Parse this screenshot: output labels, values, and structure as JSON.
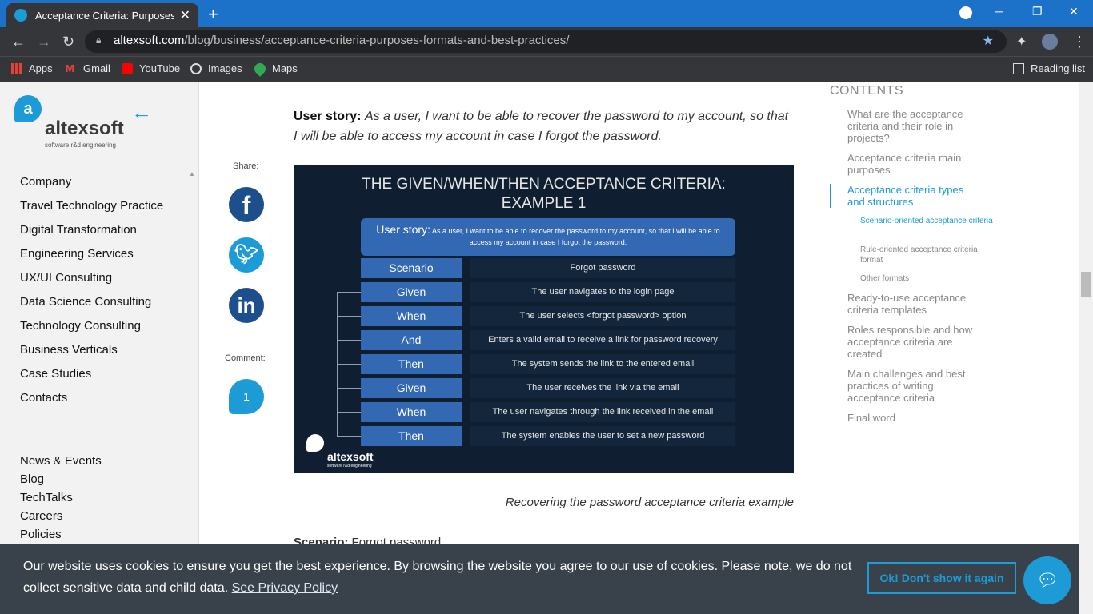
{
  "browser": {
    "tab_title": "Acceptance Criteria: Purposes, Ty",
    "tab_close": "✕",
    "new_tab": "+",
    "url_host": "altexsoft.com",
    "url_path": "/blog/business/acceptance-criteria-purposes-formats-and-best-practices/",
    "bookmarks": [
      "Apps",
      "Gmail",
      "YouTube",
      "Images",
      "Maps"
    ],
    "reading_list": "Reading list"
  },
  "logo": {
    "name": "altexsoft",
    "tagline": "software r&d engineering"
  },
  "sidebar": {
    "items": [
      "Company",
      "Travel Technology Practice",
      "Digital Transformation",
      "Engineering Services",
      "UX/UI Consulting",
      "Data Science Consulting",
      "Technology Consulting",
      "Business Verticals",
      "Case Studies",
      "Contacts"
    ],
    "secondary": [
      "News & Events",
      "Blog",
      "TechTalks",
      "Careers",
      "Policies"
    ]
  },
  "share": {
    "label": "Share:",
    "comment_label": "Comment:",
    "comment_count": "1"
  },
  "article": {
    "story_label": "User story:",
    "story_text": "As a user, I want to be able to recover the password to my account, so that I will be able to access my account in case I forgot the password.",
    "caption": "Recovering the password acceptance criteria example",
    "cut_label": "Scenario:",
    "cut_text": "Forgot password"
  },
  "infographic": {
    "title_line1": "THE GIVEN/WHEN/THEN ACCEPTANCE CRITERIA:",
    "title_line2": "EXAMPLE 1",
    "story_label": "User story:",
    "story_text": "As a user, I want to be able to recover the password to my account, so that I will be able to access my account in case I forgot the password.",
    "rows": [
      {
        "term": "Scenario",
        "desc": "Forgot password"
      },
      {
        "term": "Given",
        "desc": "The user navigates to the login page"
      },
      {
        "term": "When",
        "desc": "The user selects <forgot password> option"
      },
      {
        "term": "And",
        "desc": "Enters a valid email to receive a link for password recovery"
      },
      {
        "term": "Then",
        "desc": "The system sends the link to the entered email"
      },
      {
        "term": "Given",
        "desc": "The user receives the link via the email"
      },
      {
        "term": "When",
        "desc": "The user navigates through the link received in the email"
      },
      {
        "term": "Then",
        "desc": "The system enables the user to set a new password"
      }
    ],
    "logo_name": "altexsoft",
    "logo_sub": "software r&d engineering"
  },
  "toc": {
    "heading": "CONTENTS",
    "items": [
      "What are the acceptance criteria and their role in projects?",
      "Acceptance criteria main purposes",
      "Acceptance criteria types and structures",
      "Scenario-oriented acceptance criteria",
      "Rule-oriented acceptance criteria format",
      "Other formats",
      "Ready-to-use acceptance criteria templates",
      "Roles responsible and how acceptance criteria are created",
      "Main challenges and best practices of writing acceptance criteria",
      "Final word"
    ]
  },
  "cookie": {
    "text": "Our website uses cookies to ensure you get the best experience. By browsing the website you agree to our use of cookies. Please note, we do not collect sensitive data and child data.",
    "policy_link": "See Privacy Policy",
    "ok_button": "Ok! Don't show it again"
  },
  "colors": {
    "accent": "#1c9bd6",
    "chrome_tab": "#1c72c9",
    "infographic_bg": "#0f1e31",
    "term_bg": "#3368b3"
  }
}
